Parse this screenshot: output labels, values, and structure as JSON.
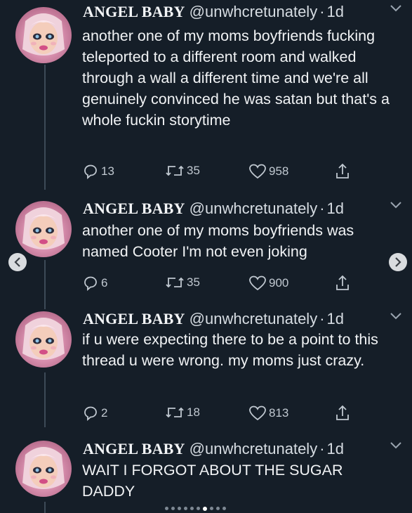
{
  "tweets": [
    {
      "name": "ANGEL BABY",
      "handle": "@unwhcretunately",
      "time": "1d",
      "text": "another one of my moms boyfriends fucking teleported to a different room and walked through a wall a different time and we're all genuinely convinced he was satan but that's a whole fuckin storytime",
      "replies": "13",
      "retweets": "35",
      "likes": "958"
    },
    {
      "name": "ANGEL BABY",
      "handle": "@unwhcretunately",
      "time": "1d",
      "text": "another one of my moms boyfriends was named Cooter I'm not even joking",
      "replies": "6",
      "retweets": "35",
      "likes": "900"
    },
    {
      "name": "ANGEL BABY",
      "handle": "@unwhcretunately",
      "time": "1d",
      "text": "if u were expecting there to be a point to this thread u were wrong. my moms just crazy.",
      "replies": "2",
      "retweets": "18",
      "likes": "813"
    },
    {
      "name": "ANGEL BABY",
      "handle": "@unwhcretunately",
      "time": "1d",
      "text": "WAIT I FORGOT ABOUT THE SUGAR DADDY"
    }
  ],
  "separator": "·",
  "carousel": {
    "total_dots": 10,
    "active_index": 6
  },
  "icons": {
    "reply": "reply-icon",
    "retweet": "retweet-icon",
    "like": "heart-icon",
    "share": "share-icon",
    "menu": "chevron-down-icon",
    "prev": "chevron-left-icon",
    "next": "chevron-right-icon"
  },
  "colors": {
    "background": "#151e28",
    "text": "#f1f3f5",
    "muted": "#c0c8d0",
    "thread_line": "#3d4a57"
  }
}
